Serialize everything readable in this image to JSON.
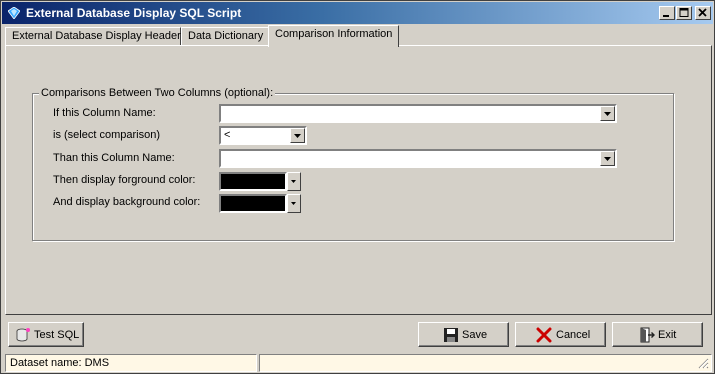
{
  "window": {
    "title": "External Database Display SQL Script",
    "icon": "diamond-icon",
    "controls": {
      "minimize": "_",
      "maximize": "□",
      "close": "×"
    }
  },
  "tabs": [
    {
      "label": "External Database Display Header",
      "active": false
    },
    {
      "label": "Data Dictionary",
      "active": false
    },
    {
      "label": "Comparison Information",
      "active": true
    }
  ],
  "comparison": {
    "group_title": "Comparisons Between Two Columns (optional):",
    "if_column_label": "If this Column Name:",
    "if_column_value": "",
    "comparison_label": "is (select comparison)",
    "comparison_value": "<",
    "than_column_label": "Than this Column Name:",
    "than_column_value": "",
    "foreground_label": "Then display forground color:",
    "foreground_color": "#000000",
    "background_label": "And display background color:",
    "background_color": "#000000"
  },
  "buttons": {
    "test_sql": "Test SQL",
    "save": "Save",
    "cancel": "Cancel",
    "exit": "Exit"
  },
  "status": {
    "dataset": "Dataset name:  DMS",
    "pane2": ""
  },
  "colors": {
    "title_gradient_start": "#0a246a",
    "title_gradient_end": "#a6caf0",
    "face": "#d4d0c8",
    "cancel_x": "#cc0000"
  }
}
